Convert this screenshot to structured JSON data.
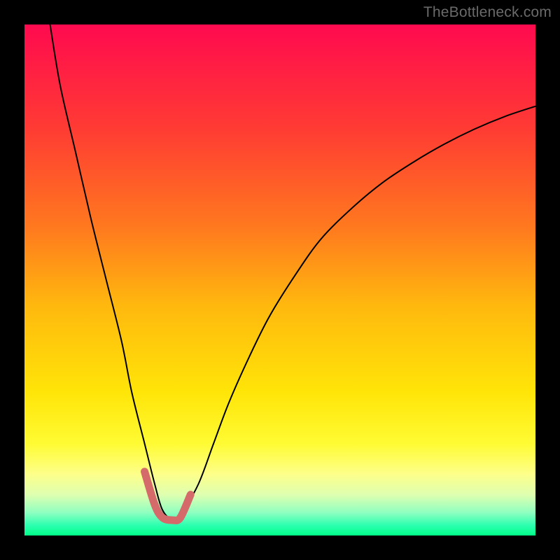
{
  "watermark": "TheBottleneck.com",
  "chart_data": {
    "type": "line",
    "title": "",
    "xlabel": "",
    "ylabel": "",
    "xlim": [
      0,
      100
    ],
    "ylim": [
      0,
      100
    ],
    "grid": false,
    "legend": false,
    "annotations": [],
    "background_gradient": {
      "stops": [
        {
          "pos": 0.0,
          "color": "#ff0a4f"
        },
        {
          "pos": 0.2,
          "color": "#ff3a34"
        },
        {
          "pos": 0.4,
          "color": "#ff7a1e"
        },
        {
          "pos": 0.55,
          "color": "#ffb80e"
        },
        {
          "pos": 0.72,
          "color": "#ffe508"
        },
        {
          "pos": 0.82,
          "color": "#fffb33"
        },
        {
          "pos": 0.88,
          "color": "#fdff8a"
        },
        {
          "pos": 0.92,
          "color": "#dfffb0"
        },
        {
          "pos": 0.955,
          "color": "#8fffc0"
        },
        {
          "pos": 0.98,
          "color": "#2cffb0"
        },
        {
          "pos": 1.0,
          "color": "#00ff88"
        }
      ]
    },
    "series": [
      {
        "name": "bottleneck-curve",
        "stroke": "#000000",
        "stroke_width": 2,
        "x": [
          5,
          7,
          10,
          13,
          16,
          19,
          21,
          23.5,
          25.5,
          27,
          29,
          30.5,
          34,
          37,
          40,
          44,
          48,
          53,
          58,
          64,
          70,
          76,
          82,
          88,
          94,
          100
        ],
        "values": [
          100,
          88,
          75,
          62,
          50,
          38,
          28,
          18,
          10,
          5,
          3,
          4,
          10,
          18,
          26,
          35,
          43,
          51,
          58,
          64,
          69,
          73,
          76.5,
          79.5,
          82,
          84
        ]
      },
      {
        "name": "trough-highlight",
        "stroke": "#d46a6a",
        "stroke_width": 11,
        "linecap": "round",
        "x": [
          23.5,
          25.5,
          27,
          29,
          30.5,
          32.5
        ],
        "values": [
          12.5,
          6,
          3.5,
          3,
          3.5,
          8
        ]
      }
    ]
  }
}
